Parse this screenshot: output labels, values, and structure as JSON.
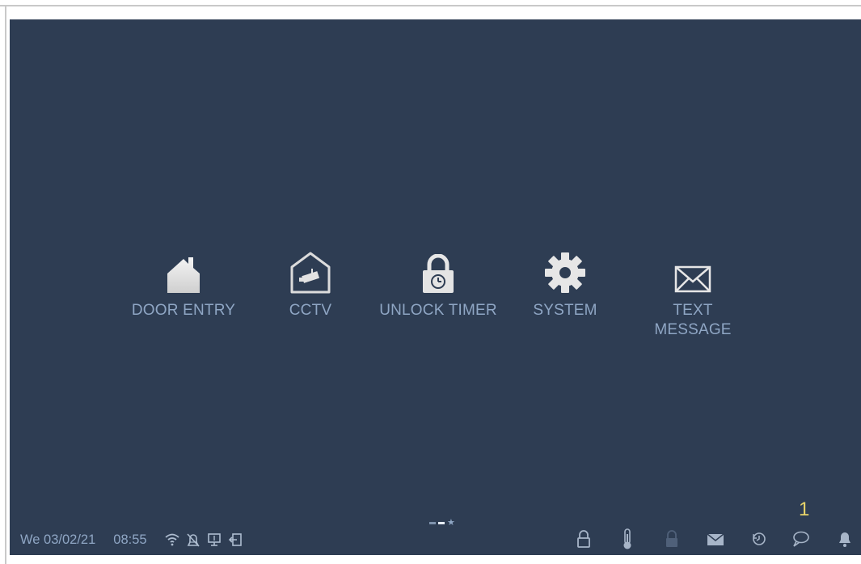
{
  "menu": [
    {
      "id": "door-entry",
      "label": "DOOR ENTRY",
      "icon": "house-icon"
    },
    {
      "id": "cctv",
      "label": "CCTV",
      "icon": "camera-house-icon"
    },
    {
      "id": "unlock-timer",
      "label": "UNLOCK TIMER",
      "icon": "padlock-timer-icon"
    },
    {
      "id": "system",
      "label": "SYSTEM",
      "icon": "gear-icon"
    },
    {
      "id": "text-message",
      "label": "TEXT\nMESSAGE",
      "icon": "envelope-icon"
    }
  ],
  "status": {
    "date": "We 03/02/21",
    "time": "08:55",
    "left_icons": [
      "wifi-icon",
      "mute-icon",
      "monitor-icon",
      "exit-icon"
    ],
    "right_icons": [
      "lock-icon",
      "thermometer-icon",
      "locked-padlock-icon",
      "mail-icon",
      "history-icon",
      "chat-icon",
      "bell-icon"
    ],
    "chat_badge": "1"
  },
  "pager": {
    "pages": 2,
    "active": 1,
    "favorites": "star-icon"
  },
  "colors": {
    "background": "#2e3d53",
    "text": "#8fa6c4",
    "icon": "#e8e8e8",
    "badge": "#e7d36a"
  }
}
